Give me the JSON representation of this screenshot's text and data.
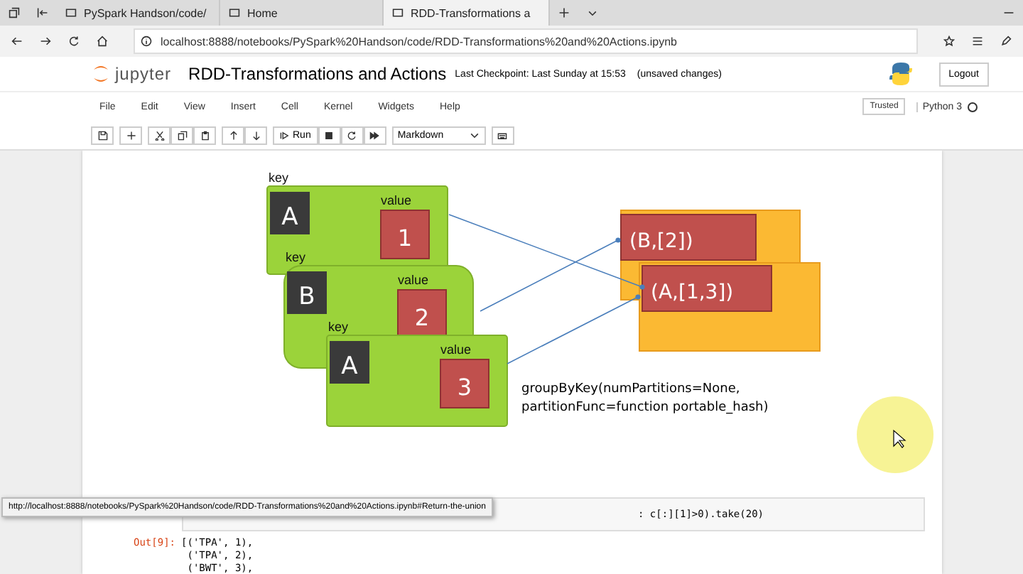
{
  "browser": {
    "tabs": [
      {
        "title": "PySpark Handson/code/",
        "selected": false
      },
      {
        "title": "Home",
        "selected": false
      },
      {
        "title": "RDD-Transformations a",
        "selected": true
      }
    ],
    "address": "localhost:8888/notebooks/PySpark%20Handson/code/RDD-Transformations%20and%20Actions.ipynb"
  },
  "header": {
    "logo_text": "jupyter",
    "notebook_title": "RDD-Transformations and Actions",
    "checkpoint": "Last Checkpoint: Last Sunday at 15:53",
    "unsaved": "(unsaved changes)",
    "logout": "Logout"
  },
  "menu": [
    "File",
    "Edit",
    "View",
    "Insert",
    "Cell",
    "Kernel",
    "Widgets",
    "Help"
  ],
  "trusted": "Trusted",
  "kernel": "Python 3",
  "toolbar": {
    "run": "Run",
    "cell_type": "Markdown"
  },
  "diagram": {
    "pairs": [
      {
        "key_label": "key",
        "key": "A",
        "value_label": "value",
        "value": "1"
      },
      {
        "key_label": "key",
        "key": "B",
        "value_label": "value",
        "value": "2"
      },
      {
        "key_label": "key",
        "key": "A",
        "value_label": "value",
        "value": "3"
      }
    ],
    "results": [
      "(B,[2])",
      "(A,[1,3])"
    ],
    "caption": [
      "groupByKey(numPartitions=None,",
      "partitionFunc=function portable_hash)"
    ]
  },
  "code_cell": {
    "code": ": c[:][1]>0).take(20)"
  },
  "output": {
    "prompt": "Out[9]:",
    "lines": [
      "[('TPA', 1),",
      " ('TPA', 2),",
      " ('BWT', 3),"
    ]
  },
  "status_url": "http://localhost:8888/notebooks/PySpark%20Handson/code/RDD-Transformations%20and%20Actions.ipynb#Return-the-union"
}
